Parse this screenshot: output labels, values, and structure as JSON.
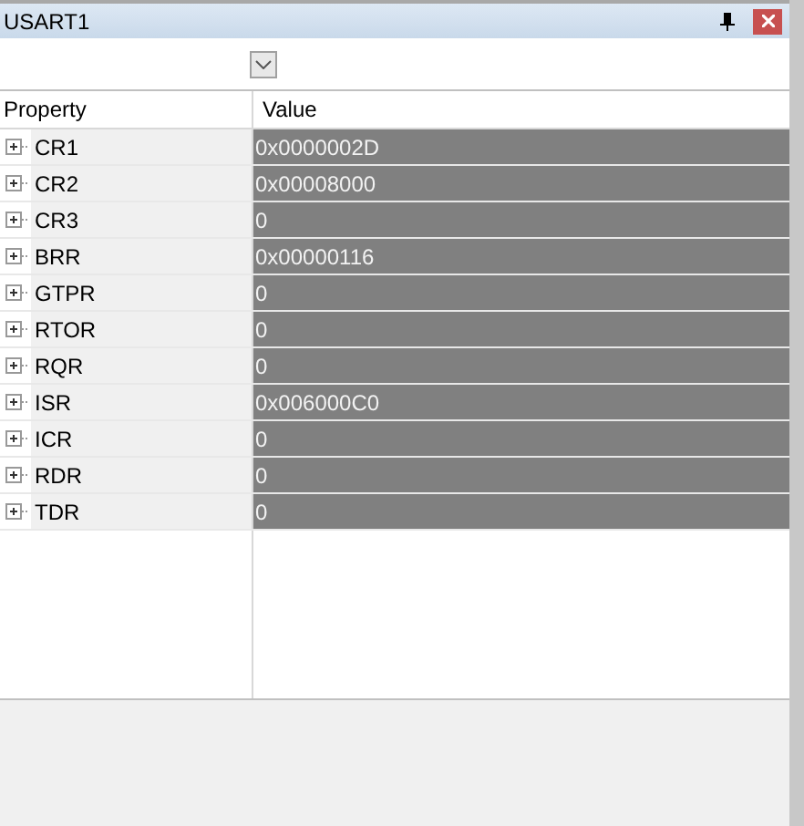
{
  "window": {
    "title": "USART1"
  },
  "table": {
    "columns": [
      "Property",
      "Value"
    ],
    "rows": [
      {
        "name": "CR1",
        "value": "0x0000002D"
      },
      {
        "name": "CR2",
        "value": "0x00008000"
      },
      {
        "name": "CR3",
        "value": "0"
      },
      {
        "name": "BRR",
        "value": "0x00000116"
      },
      {
        "name": "GTPR",
        "value": "0"
      },
      {
        "name": "RTOR",
        "value": "0"
      },
      {
        "name": "RQR",
        "value": "0"
      },
      {
        "name": "ISR",
        "value": "0x006000C0"
      },
      {
        "name": "ICR",
        "value": "0"
      },
      {
        "name": "RDR",
        "value": "0"
      },
      {
        "name": "TDR",
        "value": "0"
      }
    ]
  }
}
